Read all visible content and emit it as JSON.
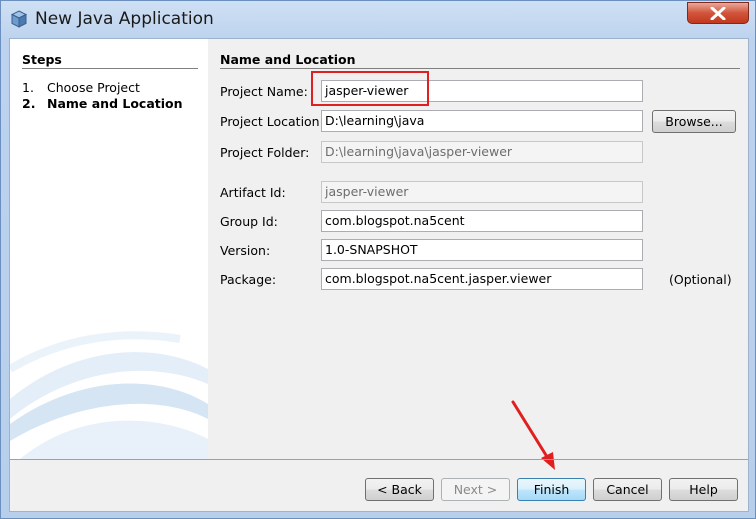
{
  "window": {
    "title": "New Java Application"
  },
  "steps": {
    "title": "Steps",
    "items": [
      {
        "num": "1.",
        "label": "Choose Project"
      },
      {
        "num": "2.",
        "label": "Name and Location"
      }
    ]
  },
  "content": {
    "title": "Name and Location",
    "fields": {
      "project_name": {
        "label": "Project Name:",
        "value": "jasper-viewer"
      },
      "project_location": {
        "label": "Project Location:",
        "value": "D:\\learning\\java"
      },
      "project_folder": {
        "label": "Project Folder:",
        "value": "D:\\learning\\java\\jasper-viewer"
      },
      "artifact_id": {
        "label": "Artifact Id:",
        "value": "jasper-viewer"
      },
      "group_id": {
        "label": "Group Id:",
        "value": "com.blogspot.na5cent"
      },
      "version": {
        "label": "Version:",
        "value": "1.0-SNAPSHOT"
      },
      "package": {
        "label": "Package:",
        "value": "com.blogspot.na5cent.jasper.viewer"
      }
    },
    "browse_label": "Browse...",
    "optional_label": "(Optional)"
  },
  "footer": {
    "back_label": "< Back",
    "next_label": "Next >",
    "finish_label": "Finish",
    "cancel_label": "Cancel",
    "help_label": "Help"
  },
  "colors": {
    "highlight": "#e02020",
    "titlebar": "#cfe0f4",
    "close": "#c1381d"
  }
}
